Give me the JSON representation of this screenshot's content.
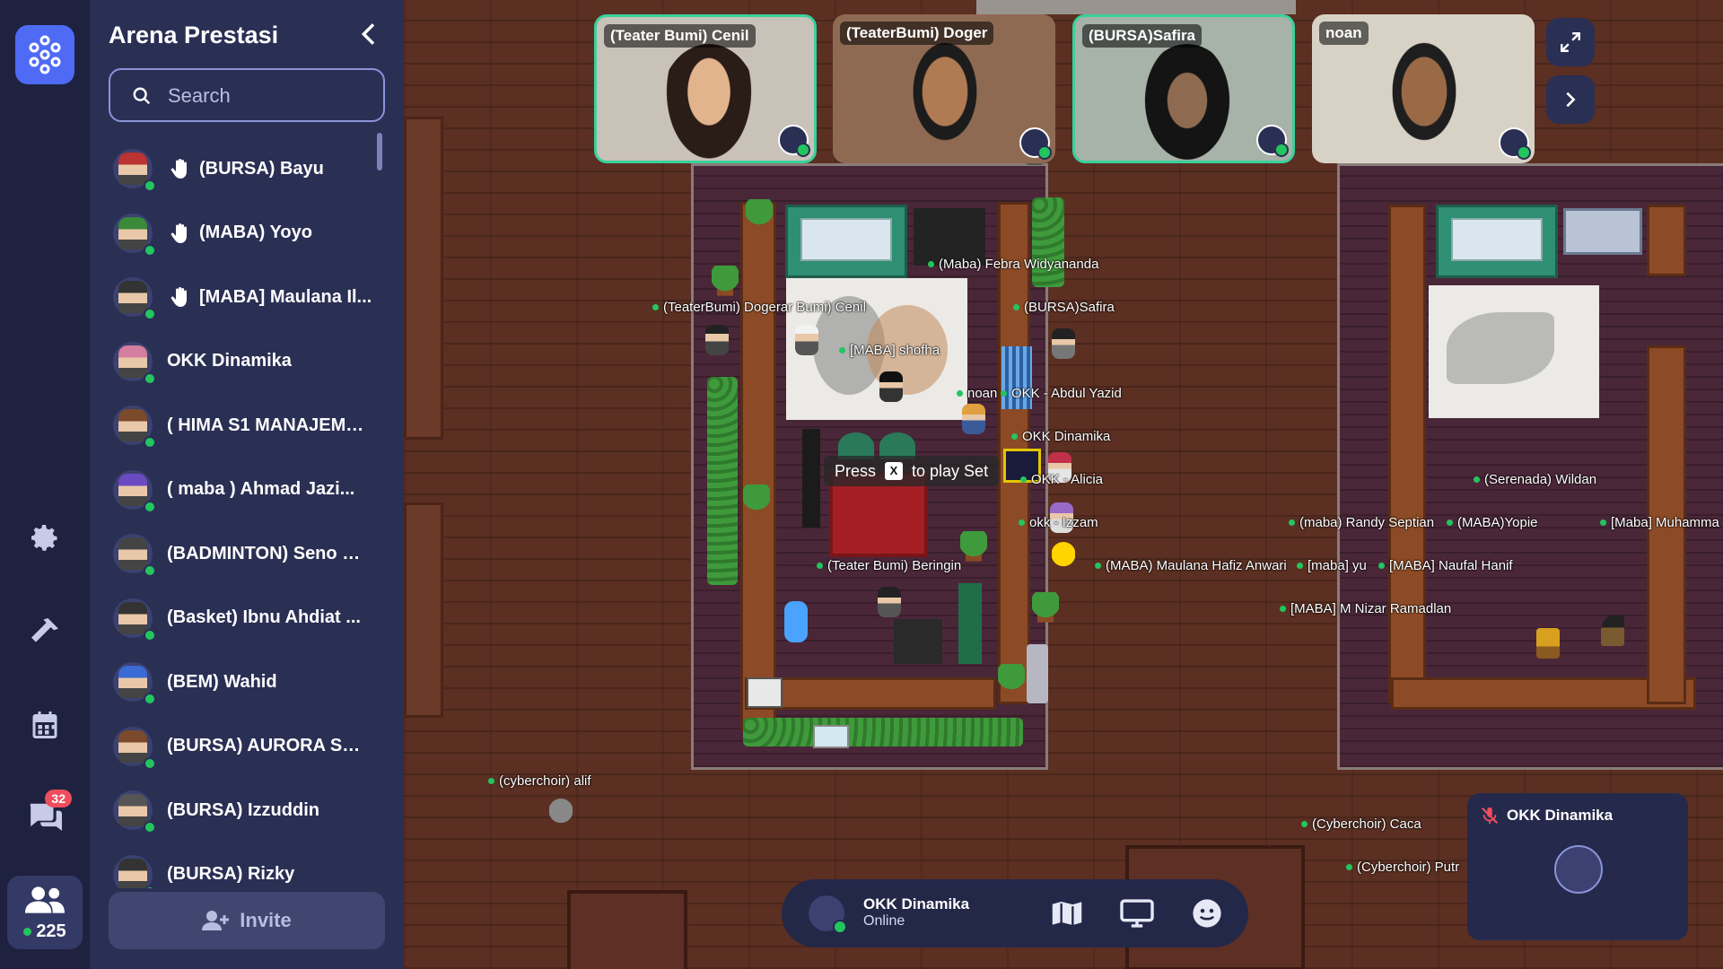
{
  "sidebar": {
    "title": "Arena Prestasi",
    "search_placeholder": "Search",
    "members": [
      {
        "name": "(BURSA) Bayu",
        "hand": true
      },
      {
        "name": "(MABA) Yoyo",
        "hand": true
      },
      {
        "name": "[MABA] Maulana Il...",
        "hand": true
      },
      {
        "name": "OKK Dinamika",
        "hand": false
      },
      {
        "name": "( HIMA S1 MANAJEME...",
        "hand": false
      },
      {
        "name": "( maba ) Ahmad Jazi...",
        "hand": false
      },
      {
        "name": "(BADMINTON) Seno B...",
        "hand": false
      },
      {
        "name": "(Basket) Ibnu Ahdiat ...",
        "hand": false
      },
      {
        "name": "(BEM) Wahid",
        "hand": false
      },
      {
        "name": "(BURSA) AURORA SH...",
        "hand": false
      },
      {
        "name": "(BURSA) Izzuddin",
        "hand": false
      },
      {
        "name": "(BURSA) Rizky",
        "hand": false
      }
    ],
    "invite_label": "Invite"
  },
  "rail": {
    "chat_badge": "32",
    "people_count": "225"
  },
  "videos": [
    {
      "name": "(Teater Bumi) Cenil"
    },
    {
      "name": "(TeaterBumi) Doger"
    },
    {
      "name": "(BURSA)Safira"
    },
    {
      "name": "noan"
    }
  ],
  "map": {
    "tip_press": "Press",
    "tip_key": "X",
    "tip_action": "to play Set",
    "labels": [
      "(Maba) Febra Widyananda",
      "(TeaterBumi) Dogerar Bumi) Cenil",
      "(BURSA)Safira",
      "[MABA] shofha",
      "noan",
      "OKK - Abdul Yazid",
      "OKK Dinamika",
      "OKK - Alicia",
      "okk - Izzam",
      "(Teater Bumi) Beringin",
      "(MABA) Maulana Hafiz Anwari",
      "[maba] yu",
      "[MABA] Naufal Hanif",
      "[MABA] M Nizar Ramadlan",
      "(maba) Randy Septian",
      "(MABA)Yopie",
      "[Maba] Muhamma",
      "(Serenada) Wildan",
      "(cyberchoir) alif",
      "(Cyberchoir) Caca",
      "(Cyberchoir) Putr"
    ]
  },
  "bottom_bar": {
    "name": "OKK Dinamika",
    "status": "Online"
  },
  "self_tile": {
    "name": "OKK Dinamika"
  },
  "colors": {
    "accent": "#4f6bf5",
    "online": "#22c55e",
    "badge": "#f04d5e",
    "sidebar": "#2a2f54"
  }
}
